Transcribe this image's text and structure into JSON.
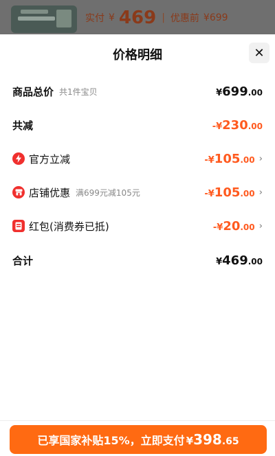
{
  "background": {
    "price_label": "实付",
    "currency": "¥",
    "price": "469",
    "separator": "|",
    "original_label": "优惠前",
    "original_price": "¥699"
  },
  "sheet": {
    "title": "价格明细",
    "close_symbol": "✕"
  },
  "rows": {
    "total": {
      "label": "商品总价",
      "note": "共1件宝贝",
      "currency": "¥",
      "int": "699",
      "dec": ".00"
    },
    "reduce": {
      "label": "共减",
      "currency": "-¥",
      "int": "230",
      "dec": ".00"
    },
    "official": {
      "label": "官方立减",
      "icon": "lightning-icon",
      "currency": "-¥",
      "int": "105",
      "dec": ".00",
      "chevron": "›"
    },
    "shop": {
      "label": "店铺优惠",
      "note": "满699元减105元",
      "icon": "shop-icon",
      "currency": "-¥",
      "int": "105",
      "dec": ".00",
      "chevron": "›"
    },
    "redpacket": {
      "label": "红包(消费券已抵)",
      "icon": "red-packet-icon",
      "currency": "-¥",
      "int": "20",
      "dec": ".00",
      "chevron": "›"
    },
    "sum": {
      "label": "合计",
      "currency": "¥",
      "int": "469",
      "dec": ".00"
    }
  },
  "pay_button": {
    "text": "已享国家补贴15%，立即支付",
    "currency": "¥",
    "int": "398",
    "dec": ".65"
  },
  "colors": {
    "accent": "#ff6a12",
    "discount": "#ff5a1f",
    "icon_red": "#f0302e"
  }
}
